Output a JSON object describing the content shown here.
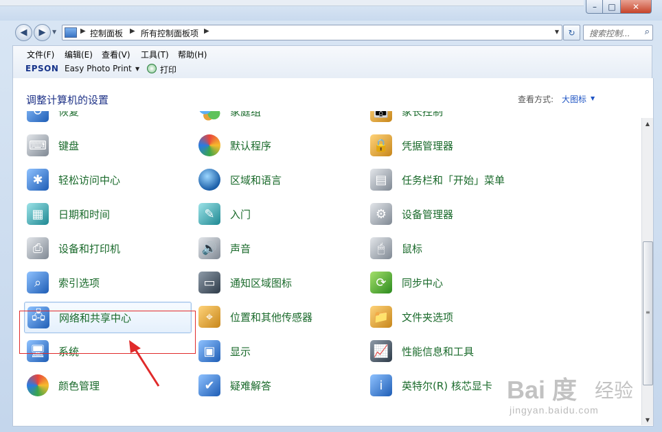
{
  "window": {
    "min_label": "–",
    "max_label": "□",
    "close_label": "✕"
  },
  "nav": {
    "back_icon": "◀",
    "forward_icon": "▶",
    "breadcrumbs": [
      "控制面板",
      "所有控制面板项"
    ],
    "search_placeholder": "搜索控制...",
    "refresh_icon": "↻"
  },
  "menu": {
    "items": [
      "文件(F)",
      "编辑(E)",
      "查看(V)",
      "工具(T)",
      "帮助(H)"
    ],
    "brand": "EPSON",
    "app": "Easy Photo Print",
    "print": "打印"
  },
  "content": {
    "heading": "调整计算机的设置",
    "view_label": "查看方式:",
    "view_value": "大图标"
  },
  "items": [
    {
      "label": "恢复",
      "icon": "recovery-icon",
      "style": "ico-blue",
      "glyph": "↺"
    },
    {
      "label": "家庭组",
      "icon": "homegroup-icon",
      "style": "ico-people",
      "glyph": ""
    },
    {
      "label": "家长控制",
      "icon": "parental-controls-icon",
      "style": "ico-orange",
      "glyph": "👪"
    },
    {
      "label": "键盘",
      "icon": "keyboard-icon",
      "style": "ico-gray",
      "glyph": "⌨"
    },
    {
      "label": "默认程序",
      "icon": "default-programs-icon",
      "style": "ico-multi",
      "glyph": ""
    },
    {
      "label": "凭据管理器",
      "icon": "credential-manager-icon",
      "style": "ico-orange",
      "glyph": "🔒"
    },
    {
      "label": "轻松访问中心",
      "icon": "ease-of-access-icon",
      "style": "ico-blue",
      "glyph": "✱"
    },
    {
      "label": "区域和语言",
      "icon": "region-language-icon",
      "style": "ico-globe",
      "glyph": ""
    },
    {
      "label": "任务栏和「开始」菜单",
      "icon": "taskbar-start-menu-icon",
      "style": "ico-gray",
      "glyph": "▤"
    },
    {
      "label": "日期和时间",
      "icon": "date-time-icon",
      "style": "ico-teal",
      "glyph": "▦"
    },
    {
      "label": "入门",
      "icon": "getting-started-icon",
      "style": "ico-teal",
      "glyph": "✎"
    },
    {
      "label": "设备管理器",
      "icon": "device-manager-icon",
      "style": "ico-gray",
      "glyph": "⚙"
    },
    {
      "label": "设备和打印机",
      "icon": "devices-printers-icon",
      "style": "ico-gray",
      "glyph": "⎙"
    },
    {
      "label": "声音",
      "icon": "sound-icon",
      "style": "ico-gray",
      "glyph": "🔊"
    },
    {
      "label": "鼠标",
      "icon": "mouse-icon",
      "style": "ico-gray",
      "glyph": "🖱"
    },
    {
      "label": "索引选项",
      "icon": "indexing-options-icon",
      "style": "ico-blue",
      "glyph": "⌕"
    },
    {
      "label": "通知区域图标",
      "icon": "notification-area-icon",
      "style": "ico-dark",
      "glyph": "▭"
    },
    {
      "label": "同步中心",
      "icon": "sync-center-icon",
      "style": "ico-green",
      "glyph": "⟳"
    },
    {
      "label": "网络和共享中心",
      "icon": "network-sharing-icon",
      "style": "ico-blue",
      "glyph": "🖧"
    },
    {
      "label": "位置和其他传感器",
      "icon": "location-sensors-icon",
      "style": "ico-orange",
      "glyph": "⌖"
    },
    {
      "label": "文件夹选项",
      "icon": "folder-options-icon",
      "style": "ico-orange",
      "glyph": "📁"
    },
    {
      "label": "系统",
      "icon": "system-icon",
      "style": "ico-blue",
      "glyph": "🖥"
    },
    {
      "label": "显示",
      "icon": "display-icon",
      "style": "ico-blue",
      "glyph": "▣"
    },
    {
      "label": "性能信息和工具",
      "icon": "performance-icon",
      "style": "ico-dark",
      "glyph": "📈"
    },
    {
      "label": "颜色管理",
      "icon": "color-management-icon",
      "style": "ico-multi",
      "glyph": ""
    },
    {
      "label": "疑难解答",
      "icon": "troubleshooting-icon",
      "style": "ico-blue",
      "glyph": "✔"
    },
    {
      "label": "英特尔(R) 核芯显卡",
      "icon": "intel-graphics-icon",
      "style": "ico-blue",
      "glyph": "i"
    }
  ],
  "selected_item": "网络和共享中心",
  "watermark": {
    "logo": "Bai 度",
    "cn": "经验",
    "url": "jingyan.baidu.com"
  }
}
